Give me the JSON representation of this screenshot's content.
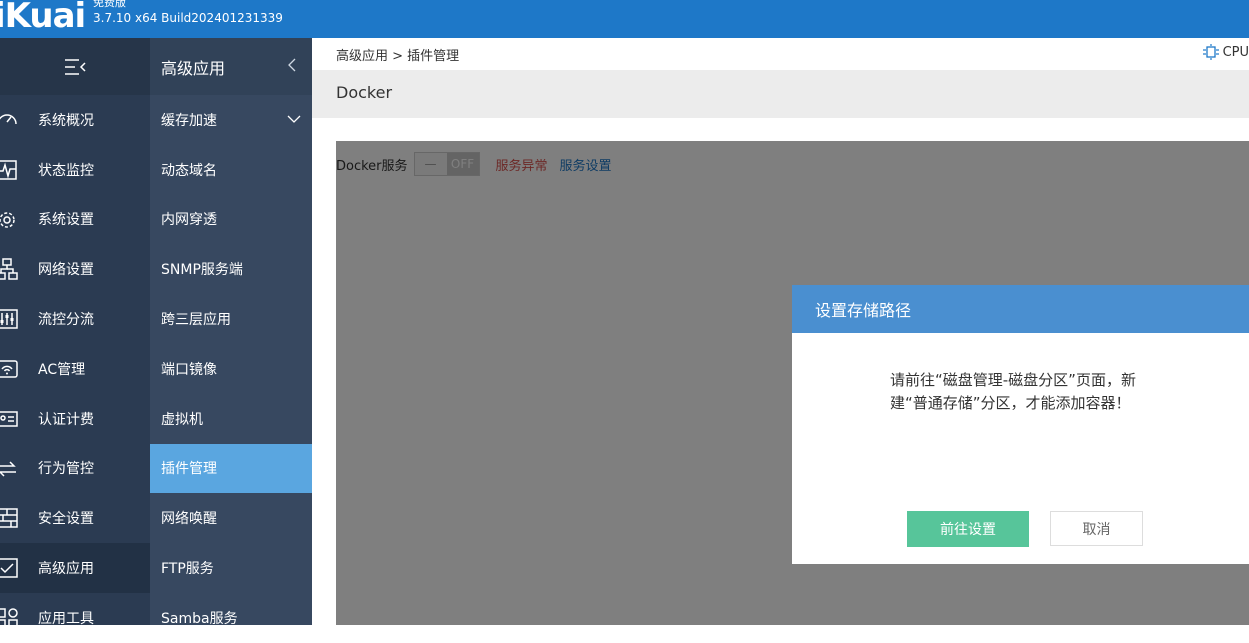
{
  "header": {
    "logo": "iKuai",
    "edition": "免费版",
    "version": "3.7.10 x64 Build202401231339"
  },
  "nav1": {
    "items": [
      {
        "label": "系统概况",
        "icon": "gauge-icon"
      },
      {
        "label": "状态监控",
        "icon": "pulse-monitor-icon"
      },
      {
        "label": "系统设置",
        "icon": "gear-icon"
      },
      {
        "label": "网络设置",
        "icon": "network-topology-icon"
      },
      {
        "label": "流控分流",
        "icon": "sliders-icon"
      },
      {
        "label": "AC管理",
        "icon": "wifi-ap-icon"
      },
      {
        "label": "认证计费",
        "icon": "id-card-icon"
      },
      {
        "label": "行为管控",
        "icon": "arrows-exchange-icon"
      },
      {
        "label": "安全设置",
        "icon": "firewall-icon"
      },
      {
        "label": "高级应用",
        "icon": "checklist-icon"
      },
      {
        "label": "应用工具",
        "icon": "tools-icon"
      }
    ],
    "active_index": 9
  },
  "nav2": {
    "title": "高级应用",
    "items": [
      {
        "label": "缓存加速"
      },
      {
        "label": "动态域名"
      },
      {
        "label": "内网穿透"
      },
      {
        "label": "SNMP服务端"
      },
      {
        "label": "跨三层应用"
      },
      {
        "label": "端口镜像"
      },
      {
        "label": "虚拟机"
      },
      {
        "label": "插件管理"
      },
      {
        "label": "网络唤醒"
      },
      {
        "label": "FTP服务"
      },
      {
        "label": "Samba服务"
      }
    ],
    "active_index": 7
  },
  "breadcrumb": "高级应用 > 插件管理",
  "cpu_label": "CPU",
  "page_title": "Docker",
  "service": {
    "label": "Docker服务",
    "toggle_knob": "—",
    "toggle_state": "OFF",
    "status": "服务异常",
    "settings_link": "服务设置"
  },
  "modal": {
    "title": "设置存储路径",
    "message": "请前往“磁盘管理-磁盘分区”页面，新建“普通存储”分区，才能添加容器！",
    "confirm": "前往设置",
    "cancel": "取消"
  },
  "colors": {
    "header": "#1e78c8",
    "nav1_bg": "#2b3b52",
    "nav2_bg": "#374860",
    "nav2_active": "#5aa6e0",
    "modal_head": "#4a8fd0",
    "confirm_btn": "#57c59a",
    "error_text": "#d9534f"
  }
}
